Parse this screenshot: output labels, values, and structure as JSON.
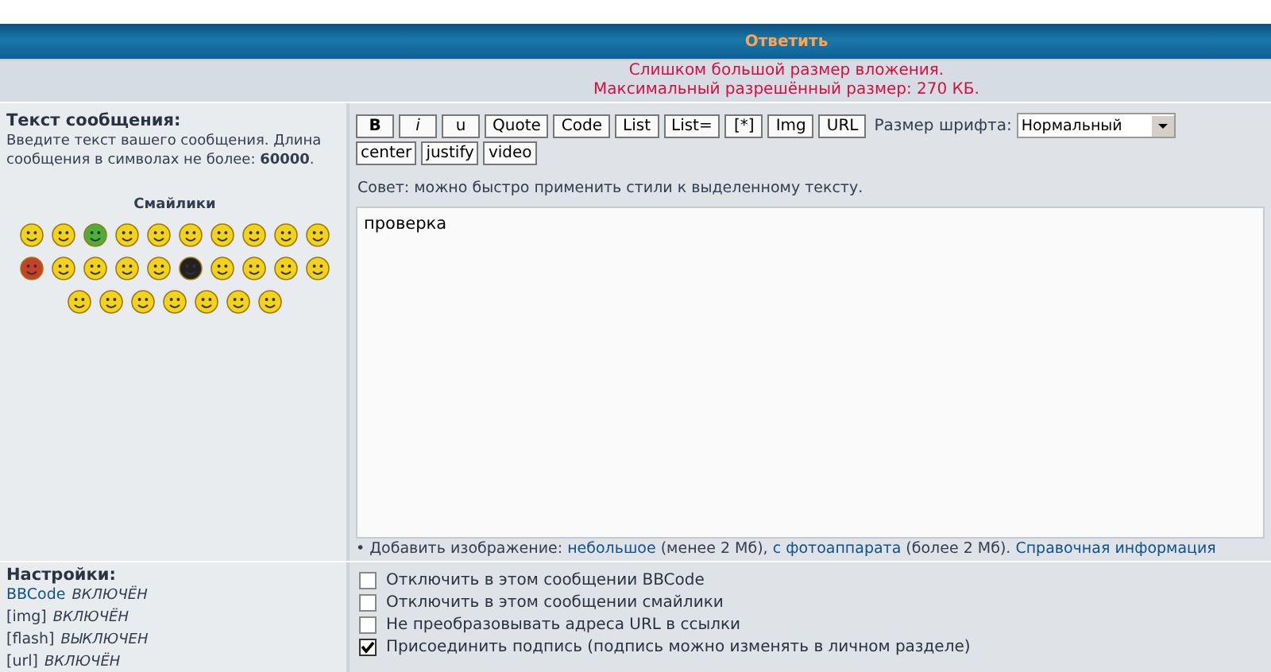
{
  "header": {
    "title": "Ответить"
  },
  "error": {
    "lines": [
      "Слишком большой размер вложения.",
      "Максимальный разрешённый размер: 270 КБ."
    ]
  },
  "message": {
    "label": "Текст сообщения:",
    "hint": "Введите текст вашего сообщения. Длина сообщения в символах не более: **60000**.",
    "smilies_title": "Смайлики",
    "buttons": [
      {
        "label": "B",
        "kind": "bold"
      },
      {
        "label": "i",
        "kind": "italic"
      },
      {
        "label": "u",
        "kind": "underline"
      },
      {
        "label": "Quote",
        "kind": "plain"
      },
      {
        "label": "Code",
        "kind": "plain"
      },
      {
        "label": "List",
        "kind": "plain"
      },
      {
        "label": "List=",
        "kind": "plain"
      },
      {
        "label": "[*]",
        "kind": "plain"
      },
      {
        "label": "Img",
        "kind": "plain"
      },
      {
        "label": "URL",
        "kind": "plain"
      }
    ],
    "font_size_label": "Размер шрифта:",
    "font_size_value": "Нормальный",
    "buttons_row2": [
      "center",
      "justify",
      "video"
    ],
    "tip": "Совет: можно быстро применить стили к выделенному тексту.",
    "text": "проверка",
    "add_image": [
      {
        "text": "• Добавить изображение: ",
        "kind": "text"
      },
      {
        "text": "небольшое",
        "kind": "link"
      },
      {
        "text": " (менее 2 Мб), ",
        "kind": "text"
      },
      {
        "text": "с фотоаппарата",
        "kind": "link"
      },
      {
        "text": " (более 2 Мб). ",
        "kind": "text"
      },
      {
        "text": "Справочная информация",
        "kind": "link"
      }
    ]
  },
  "settings": {
    "label": "Настройки:",
    "items": [
      {
        "name": "BBCode",
        "link": true,
        "state": "ВКЛЮЧЁН"
      },
      {
        "name": "[img]",
        "link": false,
        "state": "ВКЛЮЧЁН"
      },
      {
        "name": "[flash]",
        "link": false,
        "state": "ВЫКЛЮЧЕН"
      },
      {
        "name": "[url]",
        "link": false,
        "state": "ВКЛЮЧЁН"
      }
    ],
    "options": [
      {
        "label": "Отключить в этом сообщении BBCode",
        "checked": false
      },
      {
        "label": "Отключить в этом сообщении смайлики",
        "checked": false
      },
      {
        "label": "Не преобразовывать адреса URL в ссылки",
        "checked": false
      },
      {
        "label": "Присоединить подпись (подпись можно изменять в личном разделе)",
        "checked": true
      }
    ]
  }
}
